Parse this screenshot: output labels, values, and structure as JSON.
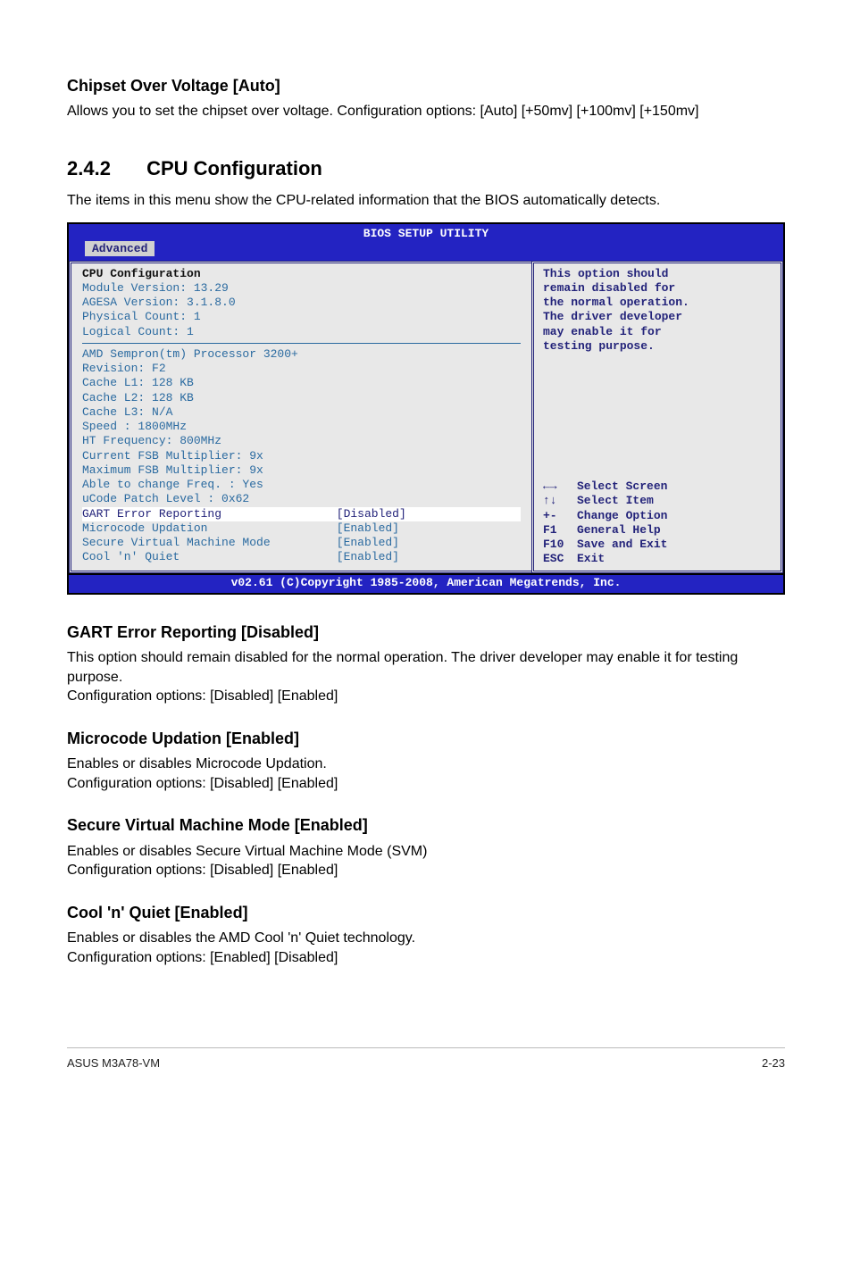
{
  "headings": {
    "chipset": "Chipset Over Voltage [Auto]",
    "section_no": "2.4.2",
    "section_title": "CPU Configuration",
    "gart": "GART Error Reporting [Disabled]",
    "microcode": "Microcode Updation [Enabled]",
    "svm": "Secure Virtual Machine Mode [Enabled]",
    "cnq": "Cool 'n' Quiet [Enabled]"
  },
  "paragraphs": {
    "chipset": "Allows you to set the chipset over voltage. Configuration options: [Auto] [+50mv] [+100mv] [+150mv]",
    "section_intro": "The items in this menu show the CPU-related information that the BIOS automatically detects.",
    "gart1": "This option should remain disabled for the normal operation. The driver developer may enable it for testing purpose.",
    "gart2": "Configuration options: [Disabled] [Enabled]",
    "microcode1": "Enables or disables Microcode Updation.",
    "microcode2": "Configuration options: [Disabled] [Enabled]",
    "svm1": "Enables or disables Secure Virtual Machine Mode (SVM)",
    "svm2": "Configuration options: [Disabled] [Enabled]",
    "cnq1": "Enables or disables the AMD Cool 'n' Quiet technology.",
    "cnq2": "Configuration options: [Enabled] [Disabled]"
  },
  "bios": {
    "title": "BIOS SETUP UTILITY",
    "tab": "Advanced",
    "header": "CPU Configuration",
    "info": [
      "Module Version: 13.29",
      "AGESA Version: 3.1.8.0",
      "Physical Count: 1",
      "Logical Count: 1"
    ],
    "cpu": [
      "AMD Sempron(tm) Processor 3200+",
      "Revision: F2",
      "Cache L1: 128 KB",
      "Cache L2: 128 KB",
      "Cache L3: N/A",
      "Speed   : 1800MHz",
      "HT Frequency: 800MHz",
      "Current FSB Multiplier: 9x",
      "Maximum FSB Multiplier: 9x",
      "Able to change Freq.  : Yes",
      "uCode Patch Level     : 0x62"
    ],
    "opts": [
      {
        "label": "GART Error Reporting",
        "value": "[Disabled]",
        "sel": true
      },
      {
        "label": "Microcode Updation",
        "value": "[Enabled]",
        "sel": false
      },
      {
        "label": "Secure Virtual Machine Mode",
        "value": "[Enabled]",
        "sel": false
      },
      {
        "label": "Cool 'n' Quiet",
        "value": "[Enabled]",
        "sel": false
      }
    ],
    "help": "This option should\nremain disabled for\nthe normal operation.\nThe driver developer\nmay enable it for\ntesting purpose.",
    "keys": [
      {
        "k": "←→",
        "t": "Select Screen"
      },
      {
        "k": "↑↓",
        "t": "Select Item"
      },
      {
        "k": "+-",
        "t": "Change Option"
      },
      {
        "k": "F1",
        "t": "General Help"
      },
      {
        "k": "F10",
        "t": "Save and Exit"
      },
      {
        "k": "ESC",
        "t": "Exit"
      }
    ],
    "footer": "v02.61 (C)Copyright 1985-2008, American Megatrends, Inc."
  },
  "page": {
    "product": "ASUS M3A78-VM",
    "num": "2-23"
  }
}
